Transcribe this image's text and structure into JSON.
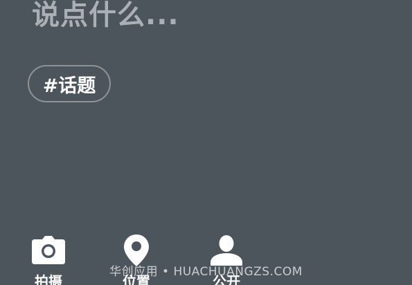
{
  "compose": {
    "placeholder": "说点什么...",
    "value": ""
  },
  "topic_chip": {
    "label": "#话题"
  },
  "toolbar": {
    "items": [
      {
        "label": "拍摄",
        "icon": "camera-icon"
      },
      {
        "label": "位置",
        "icon": "location-pin-icon"
      },
      {
        "label": "公开",
        "icon": "person-icon"
      }
    ]
  },
  "watermark": {
    "text": "华创应用 • HUACHUANGZS.COM"
  },
  "colors": {
    "background": "#4d555c",
    "placeholder": "#aab0b5",
    "chip_border": "#8c949a",
    "foreground": "#ffffff"
  }
}
